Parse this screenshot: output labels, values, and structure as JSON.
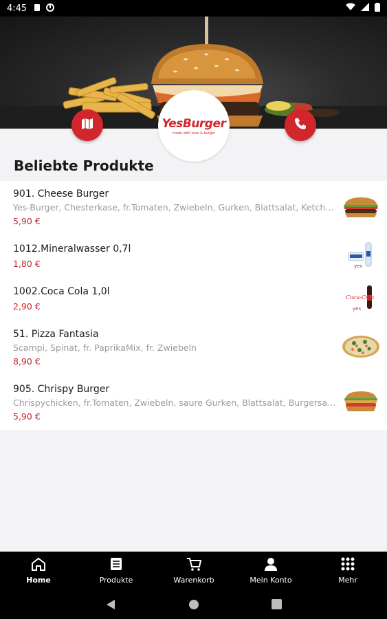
{
  "status_bar": {
    "time": "4:45"
  },
  "header": {
    "logo_text": "YesBurger",
    "logo_sub": "made with love & burger",
    "map_button_icon": "map-icon",
    "phone_button_icon": "phone-icon"
  },
  "section_title": "Beliebte Produkte",
  "products": [
    {
      "name": "901. Cheese Burger",
      "description": "Yes-Burger, Chesterkase, fr.Tomaten, Zwiebeln, Gurken, Blattsalat, Ketchup, Burgersauce",
      "price": "5,90 €",
      "image": "burger"
    },
    {
      "name": "1012.Mineralwasser 0,7l",
      "description": "",
      "price": "1,80 €",
      "image": "water-bottle"
    },
    {
      "name": "1002.Coca Cola 1,0l",
      "description": "",
      "price": "2,90 €",
      "image": "cola-bottle"
    },
    {
      "name": "51. Pizza Fantasia",
      "description": "Scampi, Spinat, fr. PaprikaMix, fr. Zwiebeln",
      "price": "8,90 €",
      "image": "pizza"
    },
    {
      "name": "905. Chrispy Burger",
      "description": "Chrispychicken, fr.Tomaten, Zwiebeln, saure Gurken, Blattsalat, Burgersauce",
      "price": "5,90 €",
      "image": "burger"
    }
  ],
  "bottom_nav": [
    {
      "label": "Home",
      "icon": "home-icon",
      "active": true
    },
    {
      "label": "Produkte",
      "icon": "menu-list-icon",
      "active": false
    },
    {
      "label": "Warenkorb",
      "icon": "cart-icon",
      "active": false
    },
    {
      "label": "Mein Konto",
      "icon": "person-icon",
      "active": false
    },
    {
      "label": "Mehr",
      "icon": "grid-icon",
      "active": false
    }
  ],
  "colors": {
    "accent": "#d0262c",
    "price": "#c4232a",
    "nav_bg": "#000000"
  }
}
